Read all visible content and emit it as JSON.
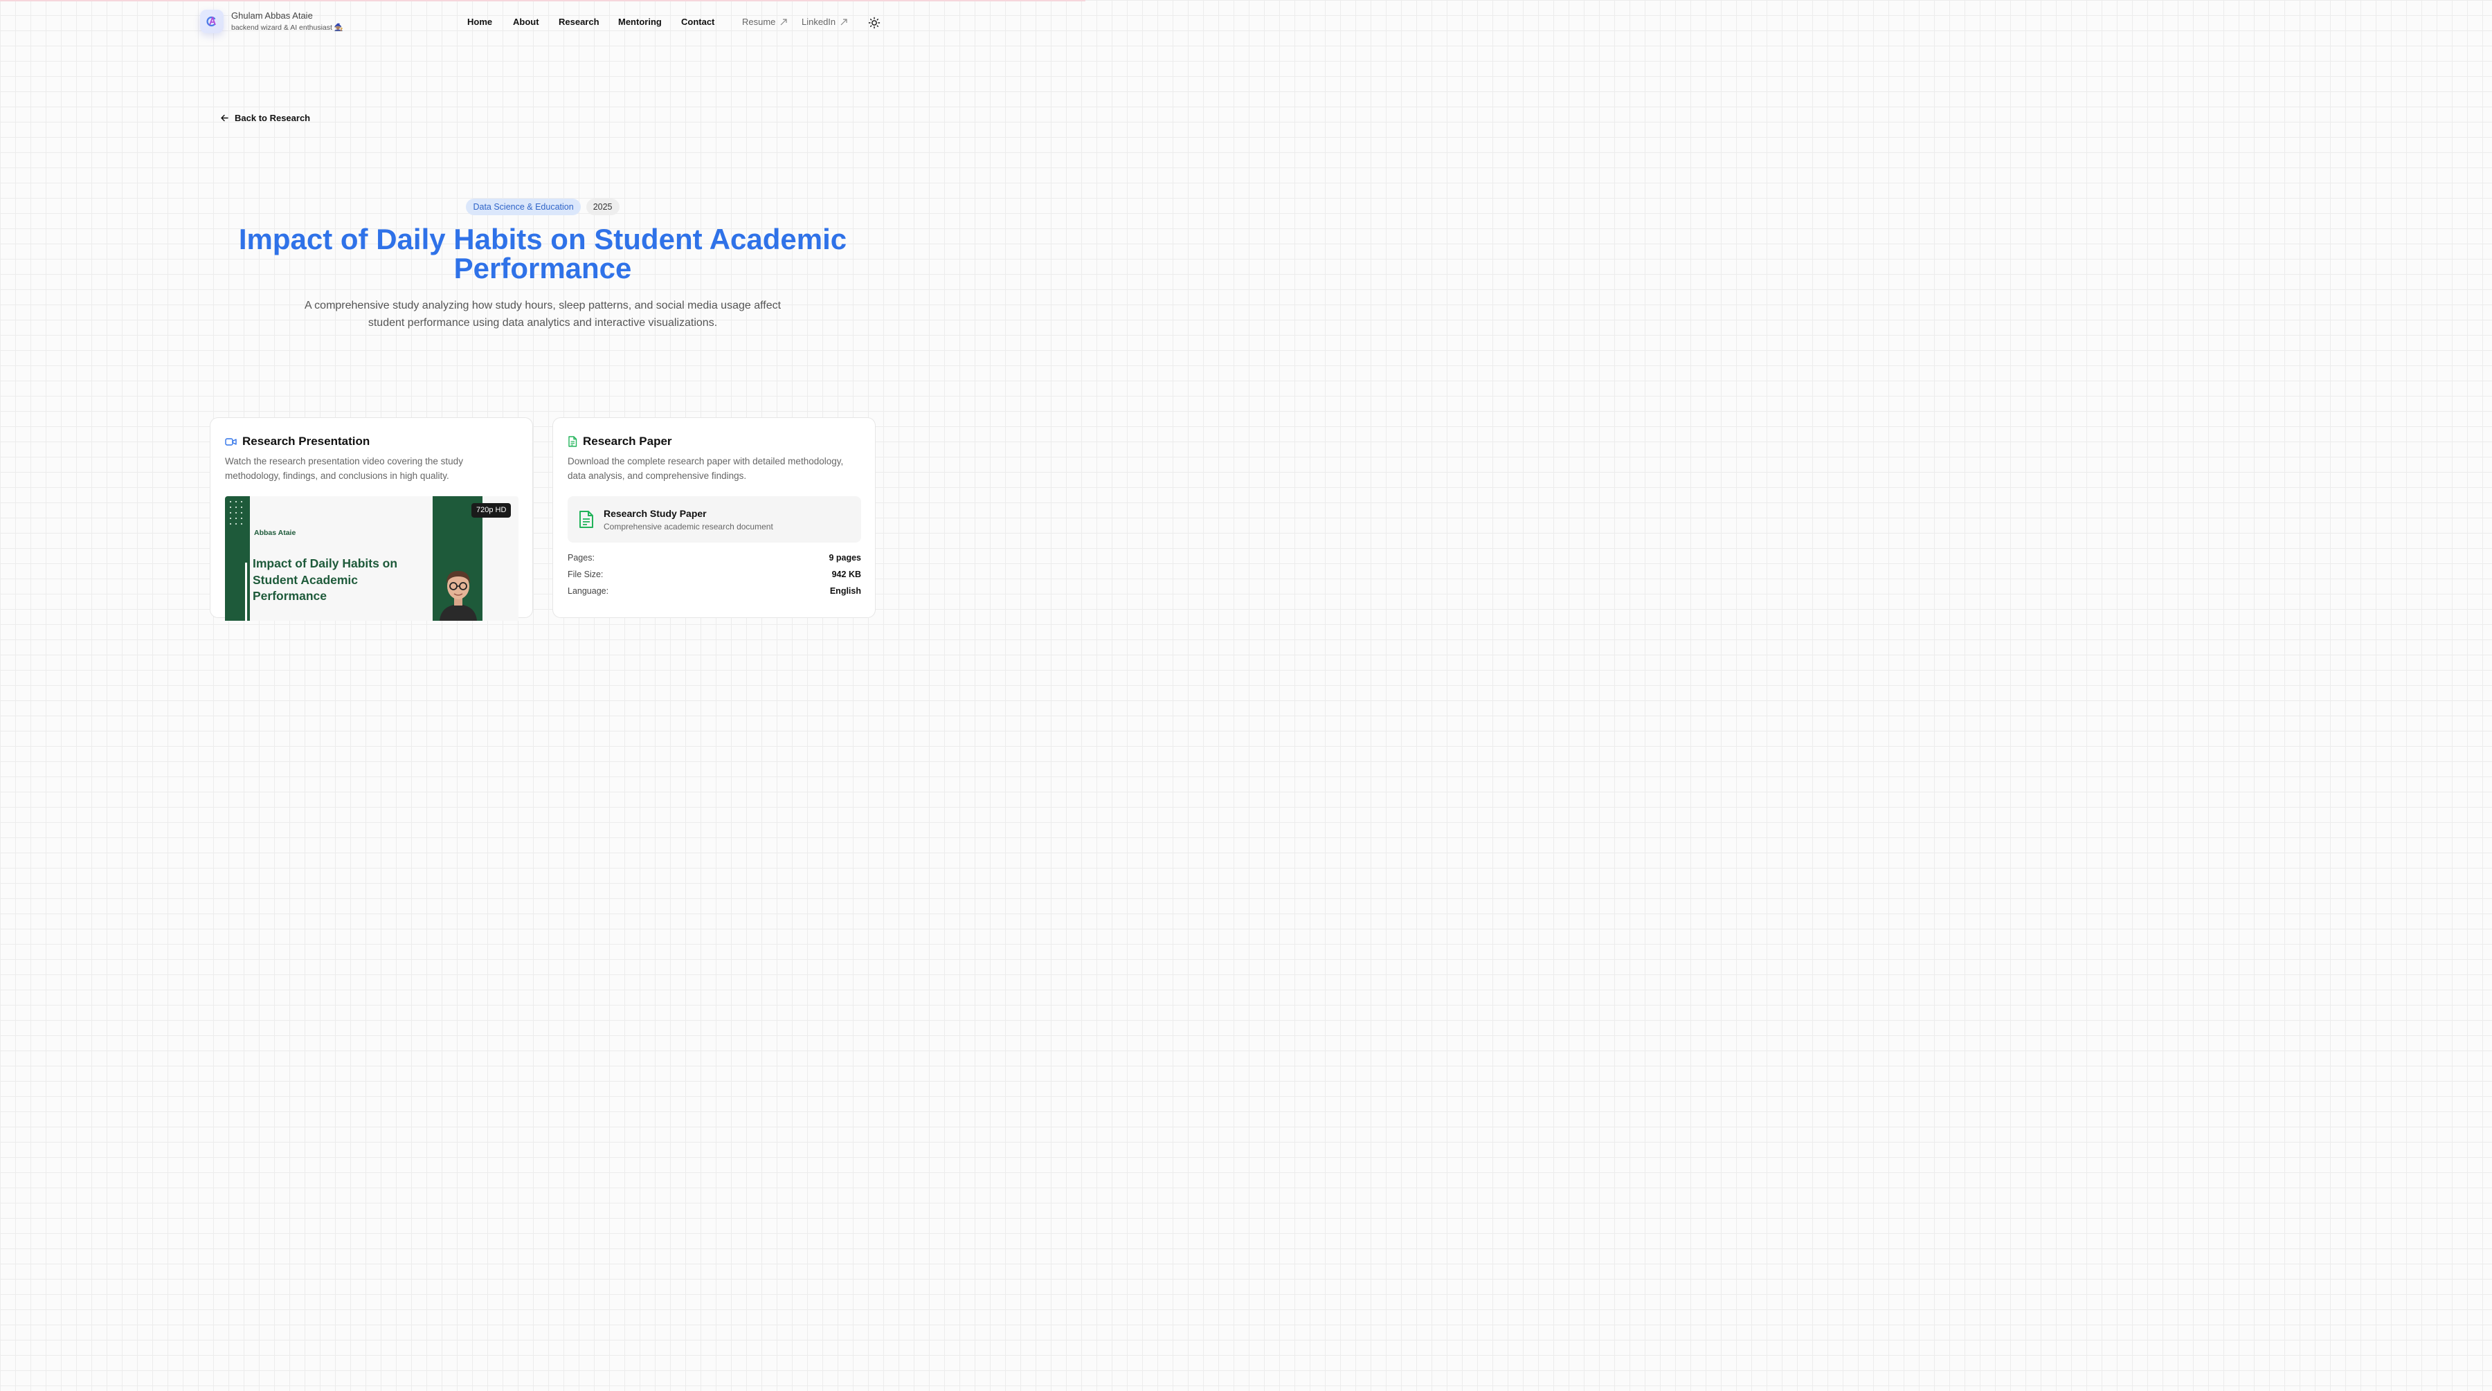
{
  "header": {
    "brand_name": "Ghulam Abbas Ataie",
    "brand_tagline": "backend wizard & AI enthusiast 🧙🏽",
    "nav": {
      "home": "Home",
      "about": "About",
      "research": "Research",
      "mentoring": "Mentoring",
      "contact": "Contact",
      "resume": "Resume",
      "linkedin": "LinkedIn"
    },
    "theme_icon": "sun-icon"
  },
  "back_link": "Back to Research",
  "hero": {
    "category": "Data Science & Education",
    "year": "2025",
    "title": "Impact of Daily Habits on Student Academic Performance",
    "subtitle": "A comprehensive study analyzing how study hours, sleep patterns, and social media usage affect student performance using data analytics and interactive visualizations."
  },
  "presentation": {
    "title": "Research Presentation",
    "description": "Watch the research presentation video covering the study methodology, findings, and conclusions in high quality.",
    "video": {
      "author": "Abbas Ataie",
      "title": "Impact of Daily Habits on Student Academic Performance",
      "quality": "720p HD"
    }
  },
  "paper": {
    "title": "Research Paper",
    "description": "Download the complete research paper with detailed methodology, data analysis, and comprehensive findings.",
    "doc_name": "Research Study Paper",
    "doc_sub": "Comprehensive academic research document",
    "meta": [
      {
        "label": "Pages:",
        "value": "9 pages"
      },
      {
        "label": "File Size:",
        "value": "942 KB"
      },
      {
        "label": "Language:",
        "value": "English"
      }
    ]
  },
  "colors": {
    "accent": "#2f72e8",
    "badge_bg": "#dbe7fb",
    "video_green": "#1e5a3a",
    "paper_green": "#22b35a"
  }
}
